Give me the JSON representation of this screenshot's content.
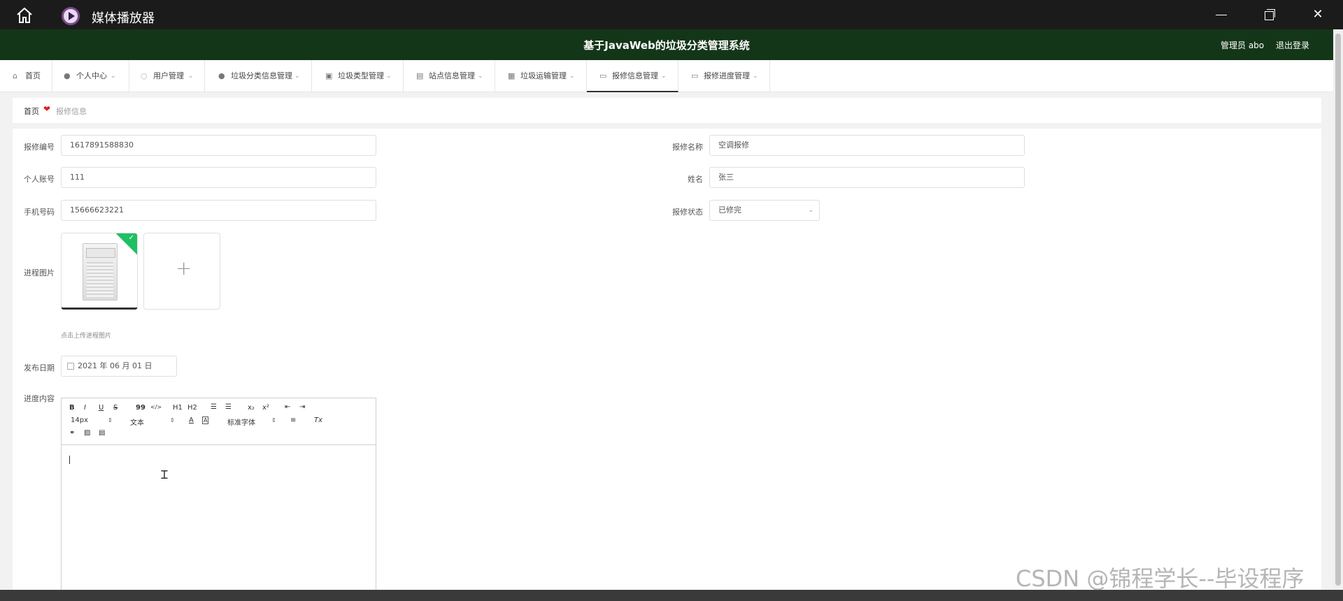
{
  "window": {
    "title": "媒体播放器",
    "minimize_glyph": "—",
    "restore_glyph": "❐",
    "close_glyph": "✕"
  },
  "header": {
    "title": "基于JavaWeb的垃圾分类管理系统",
    "user": "管理员 abo",
    "logout": "退出登录"
  },
  "nav": {
    "items": [
      {
        "label": "首页",
        "icon": "home-icon"
      },
      {
        "label": "个人中心",
        "icon": "person-icon"
      },
      {
        "label": "用户管理",
        "icon": "user-manage-icon"
      },
      {
        "label": "垃圾分类信息管理",
        "icon": "person-icon"
      },
      {
        "label": "垃圾类型管理",
        "icon": "checklist-icon"
      },
      {
        "label": "站点信息管理",
        "icon": "clipboard-icon"
      },
      {
        "label": "垃圾运输管理",
        "icon": "grid-icon"
      },
      {
        "label": "报修信息管理",
        "icon": "monitor-icon"
      },
      {
        "label": "报修进度管理",
        "icon": "card-icon"
      }
    ],
    "active": "报修信息管理"
  },
  "breadcrumb": {
    "home": "首页",
    "current": "报修信息"
  },
  "form": {
    "repair_no": {
      "label": "报修编号",
      "value": "1617891588830"
    },
    "repair_name": {
      "label": "报修名称",
      "value": "空调报修"
    },
    "account": {
      "label": "个人账号",
      "value": "111"
    },
    "name": {
      "label": "姓名",
      "value": "张三"
    },
    "phone": {
      "label": "手机号码",
      "value": "15666623221"
    },
    "status": {
      "label": "报修状态",
      "value": "已修完"
    },
    "image": {
      "label": "进程图片",
      "tip": "点击上传进程图片",
      "add_glyph": "+"
    },
    "date": {
      "label": "发布日期",
      "value": "2021 年 06 月 01 日"
    },
    "content": {
      "label": "进度内容"
    }
  },
  "editor": {
    "bold": "B",
    "italic": "I",
    "underline": "U",
    "strike": "S",
    "quote": "99",
    "code": "</>",
    "h1": "H1",
    "h2": "H2",
    "sub": "x₂",
    "sup": "x²",
    "size": "14px",
    "format": "文本",
    "font": "标准字体",
    "font_color": "A",
    "bg_color": "A",
    "clear": "Tx"
  },
  "watermark": "CSDN @锦程学长--毕设程序",
  "colors": {
    "header_bg": "#143618",
    "titlebar_bg": "#1b1b1b",
    "accent_green": "#1fbf63",
    "heart": "#e02020"
  }
}
